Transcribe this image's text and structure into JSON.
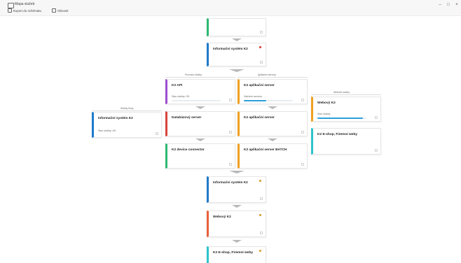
{
  "window": {
    "title": "Mapa služeb",
    "controls": [
      "–",
      "□",
      "×"
    ]
  },
  "toolbar": {
    "items": [
      {
        "label": "Export do schématu",
        "icon": "export-icon"
      },
      {
        "label": "Obnovit",
        "icon": "refresh-icon"
      }
    ]
  },
  "groups": {
    "left": "Služby firmy",
    "center_left": "Provozní služby",
    "center_right": "Aplikační servery",
    "right": "Webové služby"
  },
  "cards": {
    "top_stub": {
      "name": "",
      "color": "#2eb873"
    },
    "is_k2_top": {
      "name": "Informační systém K2",
      "color": "#1f7acb",
      "flag_color": "#d9443a"
    },
    "k2_api": {
      "name": "K2 API",
      "color": "#9b4fd1",
      "status": "Stav služby: OK",
      "progress": 0
    },
    "app_server_1": {
      "name": "K2 aplikační server",
      "color": "#f0a020",
      "status": "Zatížení serveru",
      "progress": 0.45
    },
    "webovy_k2": {
      "name": "Webový K2",
      "color": "#f0a020",
      "status": "Stav služby",
      "progress": 0.93
    },
    "is_k2_left": {
      "name": "Informační systém K2",
      "color": "#1f7acb",
      "status": "Stav služby: OK"
    },
    "db_server": {
      "name": "Databázový server",
      "color": "#d9443a"
    },
    "app_server_2": {
      "name": "K2 aplikační server",
      "color": "#f0a020"
    },
    "eshop_right": {
      "name": "K2 E-shop, Firemní weby",
      "color": "#2ec3c9"
    },
    "k2_device": {
      "name": "K2 device connector",
      "color": "#2eb873"
    },
    "app_server_batch": {
      "name": "K2 aplikační server BATCH",
      "color": "#f0a020"
    },
    "is_k2_bottom": {
      "name": "Informační systém K2",
      "color": "#1f7acb",
      "flag_color": "#d9a53a"
    },
    "webovy_k2_bottom": {
      "name": "Webový K2",
      "color": "#e8603a",
      "flag_color": "#d9a53a"
    },
    "eshop_bottom": {
      "name": "K2 E-shop, Firemní weby",
      "color": "#2ec3c9",
      "flag_color": "#d9a53a"
    }
  },
  "footer": {
    "text": ""
  }
}
